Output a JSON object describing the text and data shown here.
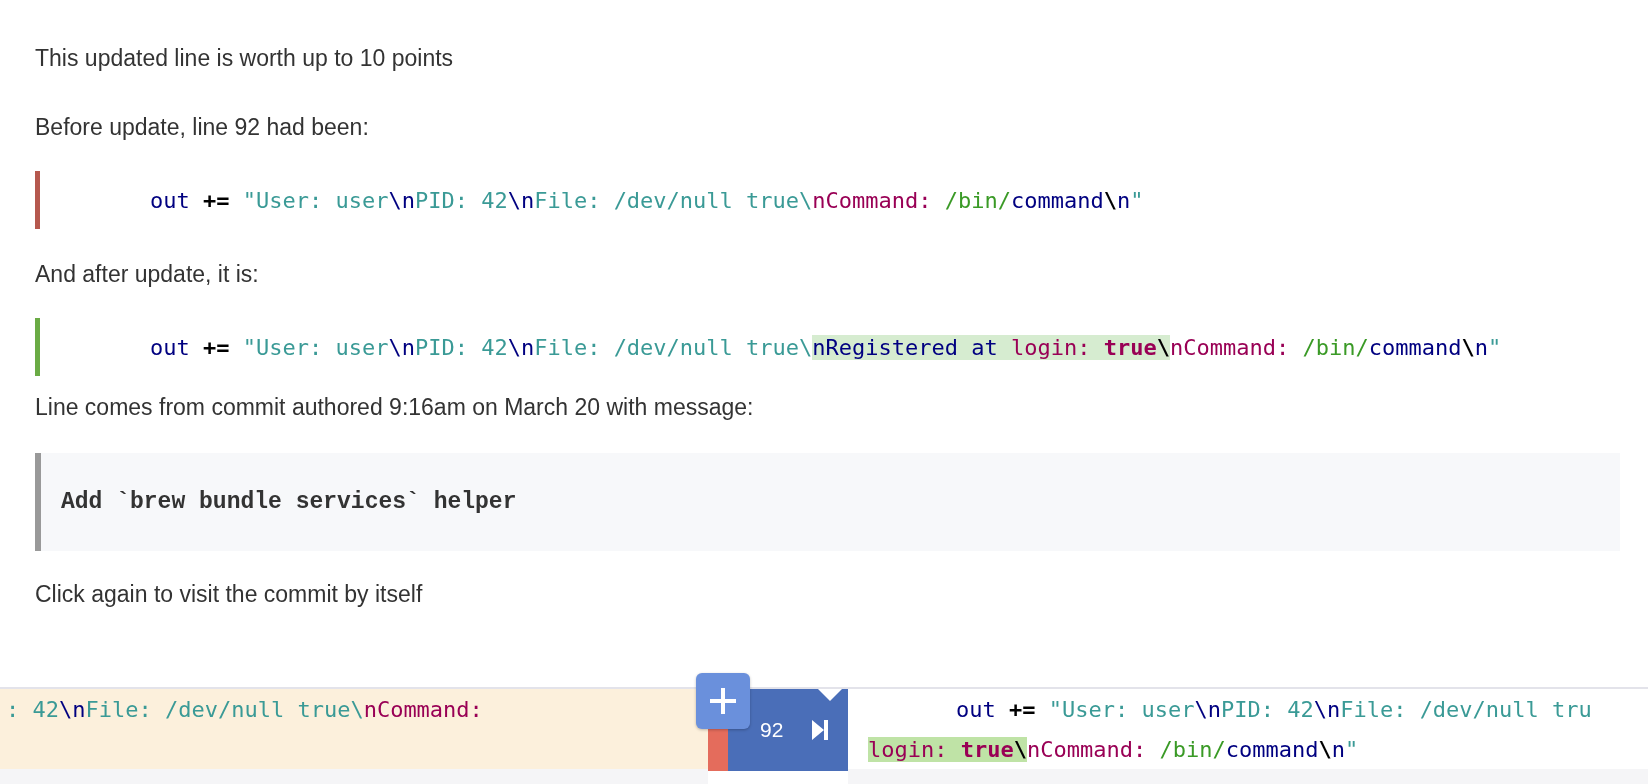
{
  "intro": "This updated line is worth up to 10 points",
  "before_label": "Before update, line 92 had been:",
  "before_line": {
    "kind": "removed",
    "tokens": [
      {
        "text": "out",
        "kind": "var",
        "highlighted": false
      },
      {
        "text": " += ",
        "kind": "op",
        "highlighted": false
      },
      {
        "text": "\"User: user",
        "kind": "str",
        "highlighted": false
      },
      {
        "text": "\\n",
        "kind": "esc",
        "highlighted": false
      },
      {
        "text": "PID: 42",
        "kind": "str",
        "highlighted": false
      },
      {
        "text": "\\n",
        "kind": "esc",
        "highlighted": false
      },
      {
        "text": "File: /dev/null true\\",
        "kind": "str",
        "highlighted": false
      },
      {
        "text": "nCommand:",
        "kind": "key",
        "highlighted": false
      },
      {
        "text": " /bin/",
        "kind": "path",
        "highlighted": false
      },
      {
        "text": "command",
        "kind": "var",
        "highlighted": false
      },
      {
        "text": "\\",
        "kind": "op",
        "highlighted": false
      },
      {
        "text": "n",
        "kind": "var",
        "highlighted": false
      },
      {
        "text": "\"",
        "kind": "str",
        "highlighted": false
      }
    ]
  },
  "after_label": "And after update, it is:",
  "after_line": {
    "kind": "added",
    "tokens": [
      {
        "text": "out",
        "kind": "var",
        "highlighted": false
      },
      {
        "text": " += ",
        "kind": "op",
        "highlighted": false
      },
      {
        "text": "\"User: user",
        "kind": "str",
        "highlighted": false
      },
      {
        "text": "\\n",
        "kind": "esc",
        "highlighted": false
      },
      {
        "text": "PID: 42",
        "kind": "str",
        "highlighted": false
      },
      {
        "text": "\\n",
        "kind": "esc",
        "highlighted": false
      },
      {
        "text": "File: /dev/null true\\",
        "kind": "str",
        "highlighted": false
      },
      {
        "text": "nRegistered at ",
        "kind": "var",
        "highlighted": true
      },
      {
        "text": "login: ",
        "kind": "key",
        "highlighted": true
      },
      {
        "text": "true",
        "kind": "kw",
        "highlighted": true
      },
      {
        "text": "\\",
        "kind": "op",
        "highlighted": true
      },
      {
        "text": "nCommand:",
        "kind": "key",
        "highlighted": false
      },
      {
        "text": " /bin/",
        "kind": "path",
        "highlighted": false
      },
      {
        "text": "command",
        "kind": "var",
        "highlighted": false
      },
      {
        "text": "\\",
        "kind": "op",
        "highlighted": false
      },
      {
        "text": "n",
        "kind": "var",
        "highlighted": false
      },
      {
        "text": "\"",
        "kind": "str",
        "highlighted": false
      }
    ]
  },
  "commit_label": "Line comes from commit authored 9:16am on March 20 with message:",
  "commit_message": "Add `brew bundle services` helper",
  "footer_text": "Click again to visit the commit by itself",
  "diff_view": {
    "line_number": "92",
    "left_lines": [
      {
        "tokens": [
          {
            "text": ": 42",
            "kind": "str",
            "highlighted": false
          },
          {
            "text": "\\n",
            "kind": "esc",
            "highlighted": false
          },
          {
            "text": "File: /dev/null true\\",
            "kind": "str",
            "highlighted": false
          },
          {
            "text": "nCommand:",
            "kind": "key",
            "highlighted": false
          }
        ]
      }
    ],
    "right_lines": [
      {
        "tokens": [
          {
            "text": "out",
            "kind": "var",
            "highlighted": false
          },
          {
            "text": " += ",
            "kind": "op",
            "highlighted": false
          },
          {
            "text": "\"User: user",
            "kind": "str",
            "highlighted": false
          },
          {
            "text": "\\n",
            "kind": "esc",
            "highlighted": false
          },
          {
            "text": "PID: 42",
            "kind": "str",
            "highlighted": false
          },
          {
            "text": "\\n",
            "kind": "esc",
            "highlighted": false
          },
          {
            "text": "File: /dev/null tru",
            "kind": "str",
            "highlighted": false
          }
        ]
      },
      {
        "tokens": [
          {
            "text": "login: ",
            "kind": "key",
            "highlighted": true
          },
          {
            "text": "true",
            "kind": "kw",
            "highlighted": true
          },
          {
            "text": "\\",
            "kind": "op",
            "highlighted": true
          },
          {
            "text": "nCommand:",
            "kind": "key",
            "highlighted": false
          },
          {
            "text": " /bin/",
            "kind": "path",
            "highlighted": false
          },
          {
            "text": "command",
            "kind": "var",
            "highlighted": false
          },
          {
            "text": "\\",
            "kind": "op",
            "highlighted": false
          },
          {
            "text": "n",
            "kind": "var",
            "highlighted": false
          },
          {
            "text": "\"",
            "kind": "str",
            "highlighted": false
          }
        ]
      }
    ]
  }
}
